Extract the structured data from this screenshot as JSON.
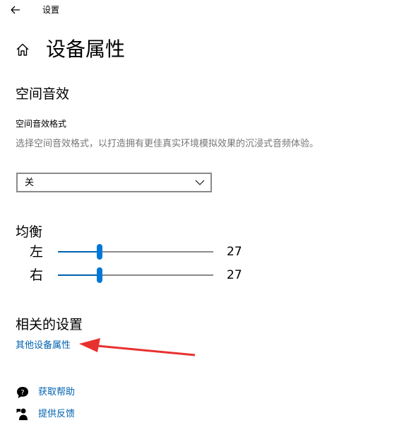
{
  "window": {
    "title": "设置"
  },
  "page": {
    "title": "设备属性"
  },
  "spatial_audio": {
    "title": "空间音效",
    "format_label": "空间音效格式",
    "description": "选择空间音效格式，以打造拥有更佳真实环境模拟效果的沉浸式音频体验。",
    "selected_value": "关",
    "icon": "chevron-down-icon"
  },
  "balance": {
    "title": "均衡",
    "channels": [
      {
        "label": "左",
        "value": "27",
        "level_percent": 27
      },
      {
        "label": "右",
        "value": "27",
        "level_percent": 27
      }
    ],
    "accent_color": "#0078d7"
  },
  "related": {
    "title": "相关的设置",
    "link": "其他设备属性",
    "annotation_arrow_color": "#e8312f"
  },
  "help": {
    "get_help": "获取帮助",
    "feedback": "提供反馈",
    "icons": [
      "get-help-icon",
      "feedback-icon"
    ]
  },
  "link_color": "#0063b1"
}
